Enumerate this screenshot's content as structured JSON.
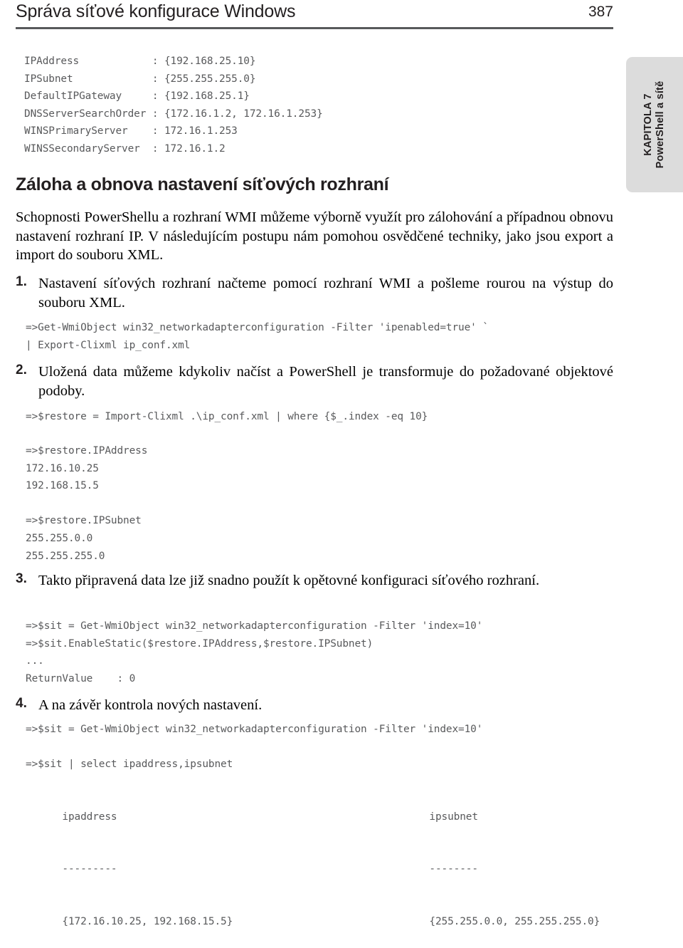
{
  "header": {
    "title": "Správa síťové konfigurace Windows",
    "page_number": "387"
  },
  "chapter_tab": {
    "line1": "KAPITOLA 7",
    "line2": "PowerShell a sítě"
  },
  "top_console_output": "IPAddress            : {192.168.25.10}\nIPSubnet             : {255.255.255.0}\nDefaultIPGateway     : {192.168.25.1}\nDNSServerSearchOrder : {172.16.1.2, 172.16.1.253}\nWINSPrimaryServer    : 172.16.1.253\nWINSSecondaryServer  : 172.16.1.2",
  "section": {
    "heading": "Záloha a obnova nastavení síťových rozhraní",
    "intro": "Schopnosti PowerShellu a rozhraní WMI můžeme výborně využít pro zálohování a případnou obnovu nastavení rozhraní IP. V následujícím postupu nám pomohou osvědčené techniky, jako jsou export a import do souboru XML."
  },
  "steps": [
    {
      "number": "1.",
      "text": "Nastavení síťových rozhraní načteme pomocí rozhraní WMI a pošleme rourou na výstup do souboru XML.",
      "code": "=>Get-WmiObject win32_networkadapterconfiguration -Filter 'ipenabled=true' `\n| Export-Clixml ip_conf.xml"
    },
    {
      "number": "2.",
      "text": "Uložená data můžeme kdykoliv načíst a PowerShell je transformuje do požadované objektové podoby.",
      "code": "=>$restore = Import-Clixml .\\ip_conf.xml | where {$_.index -eq 10}",
      "output": "=>$restore.IPAddress\n172.16.10.25\n192.168.15.5\n\n=>$restore.IPSubnet\n255.255.0.0\n255.255.255.0"
    },
    {
      "number": "3.",
      "text": "Takto připravená data lze již snadno použít k opětovné konfiguraci síťového rozhraní.",
      "code": "=>$sit = Get-WmiObject win32_networkadapterconfiguration -Filter 'index=10'\n=>$sit.EnableStatic($restore.IPAddress,$restore.IPSubnet)\n...\nReturnValue    : 0"
    },
    {
      "number": "4.",
      "text": "A na závěr kontrola nových nastavení.",
      "code": "=>$sit = Get-WmiObject win32_networkadapterconfiguration -Filter 'index=10'",
      "code2": "=>$sit | select ipaddress,ipsubnet"
    }
  ],
  "final_table": {
    "header_a": "ipaddress",
    "header_b": "ipsubnet",
    "rule_a": "---------",
    "rule_b": "--------",
    "value_a": "{172.16.10.25, 192.168.15.5}",
    "value_b": "{255.255.0.0, 255.255.255.0}"
  },
  "colors": {
    "rule": "#58595b",
    "code_text": "#58595b",
    "tab_background": "#dcdcdc",
    "body_text": "#000000"
  }
}
